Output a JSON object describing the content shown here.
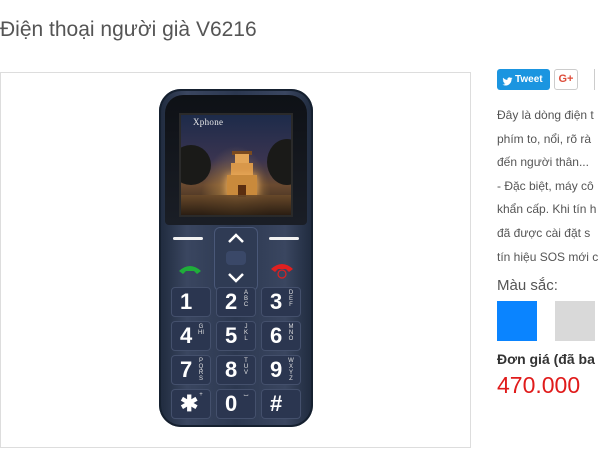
{
  "product": {
    "title": "Điện thoại người già V6216"
  },
  "gallery": {
    "phone_brand": "Xphone",
    "keys": [
      {
        "num": "1",
        "letters": ""
      },
      {
        "num": "2",
        "letters": "ABC"
      },
      {
        "num": "3",
        "letters": "DEF"
      },
      {
        "num": "4",
        "letters": "GHI"
      },
      {
        "num": "5",
        "letters": "JKL"
      },
      {
        "num": "6",
        "letters": "MNO"
      },
      {
        "num": "7",
        "letters": "PQRS"
      },
      {
        "num": "8",
        "letters": "TUV"
      },
      {
        "num": "9",
        "letters": "WXYZ"
      },
      {
        "num": "✱",
        "letters": "+"
      },
      {
        "num": "0",
        "letters": "⌴"
      },
      {
        "num": "#",
        "letters": ""
      }
    ]
  },
  "social": {
    "tweet_label": "Tweet",
    "gplus_label": "G+"
  },
  "description": {
    "lines": [
      "Đây là dòng điện t",
      "phím to, nổi, rõ rà",
      "đến người thân...",
      "- Đặc biệt, máy cô",
      "khẩn cấp. Khi tín h",
      "đã được cài đặt s",
      "tín hiệu SOS mới c"
    ]
  },
  "colors": {
    "label": "Màu sắc:",
    "options": [
      "#0a84ff",
      "#d9d9d9"
    ]
  },
  "pricing": {
    "label": "Đơn giá (đã ba",
    "price": "470.000"
  },
  "accent": {
    "price_color": "#e01b1b",
    "tweet_color": "#1b95e0"
  }
}
